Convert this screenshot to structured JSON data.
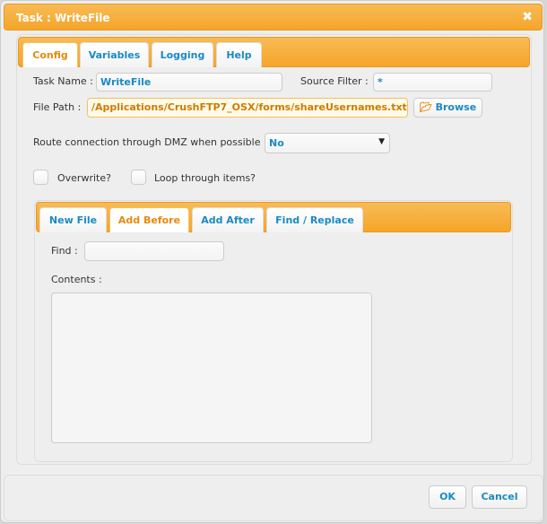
{
  "dialog": {
    "title": "Task : WriteFile",
    "close": "✖"
  },
  "tabs": [
    "Config",
    "Variables",
    "Logging",
    "Help"
  ],
  "active_tab": "Config",
  "form": {
    "task_name_label": "Task Name :",
    "task_name_value": "WriteFile",
    "source_filter_label": "Source Filter :",
    "source_filter_value": "*",
    "file_path_label": "File Path :",
    "file_path_value": "/Applications/CrushFTP7_OSX/forms/shareUsernames.txt",
    "browse_label": "Browse",
    "route_label": "Route connection through DMZ when possible :",
    "route_value": "No",
    "overwrite_label": "Overwrite?",
    "overwrite_checked": false,
    "loop_label": "Loop through items?",
    "loop_checked": false
  },
  "subtabs": [
    "New File",
    "Add Before",
    "Add After",
    "Find / Replace"
  ],
  "active_subtab": "Add Before",
  "sub": {
    "find_label": "Find :",
    "find_value": "",
    "contents_label": "Contents :",
    "contents_value": ""
  },
  "footer": {
    "ok": "OK",
    "cancel": "Cancel"
  }
}
